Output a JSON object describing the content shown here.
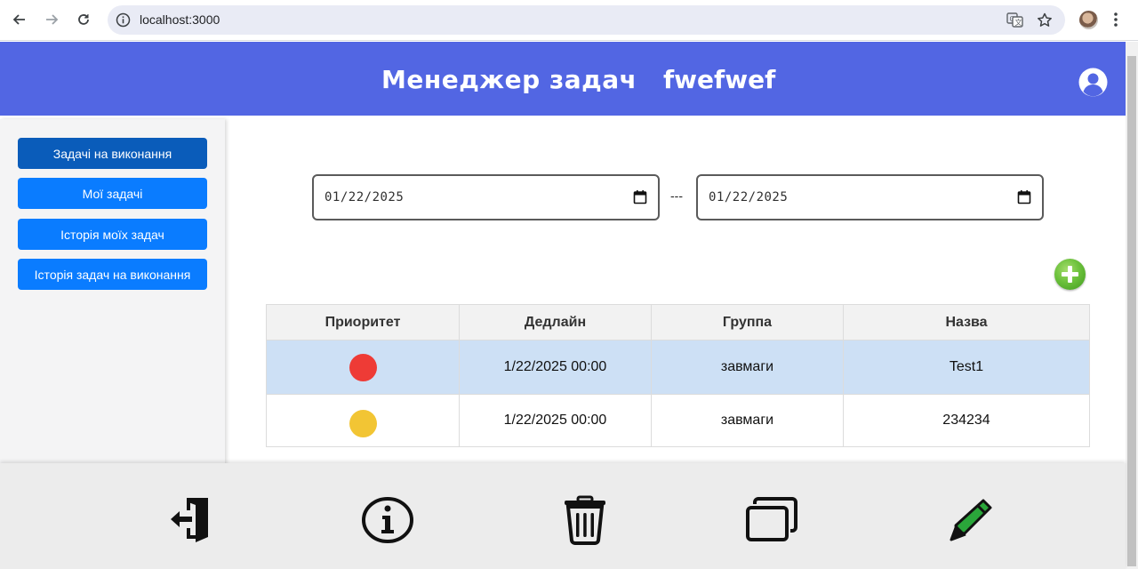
{
  "browser": {
    "url": "localhost:3000"
  },
  "header": {
    "title": "Менеджер задач",
    "username": "fwefwef",
    "accent": "#5266e3"
  },
  "sidebar": {
    "items": [
      {
        "label": "Задачі на виконання",
        "active": true
      },
      {
        "label": "Мої задачі",
        "active": false
      },
      {
        "label": "Історія моїх задач",
        "active": false
      },
      {
        "label": "Історія задач на виконання",
        "active": false
      }
    ],
    "button_color": "#0a7cff",
    "active_color": "#0a5cba"
  },
  "filters": {
    "date_from": "01/22/2025",
    "separator": "---",
    "date_to": "01/22/2025"
  },
  "table": {
    "headers": [
      "Приоритет",
      "Дедлайн",
      "Группа",
      "Назва"
    ],
    "rows": [
      {
        "priority_color": "#ee3b36",
        "deadline": "1/22/2025 00:00",
        "group": "завмаги",
        "name": "Test1",
        "selected": true
      },
      {
        "priority_color": "#f2c534",
        "deadline": "1/22/2025 00:00",
        "group": "завмаги",
        "name": "234234",
        "selected": false
      }
    ]
  },
  "toolbar": {
    "icons": [
      "logout-icon",
      "info-icon",
      "trash-icon",
      "copy-icon",
      "edit-pencil-icon"
    ]
  }
}
